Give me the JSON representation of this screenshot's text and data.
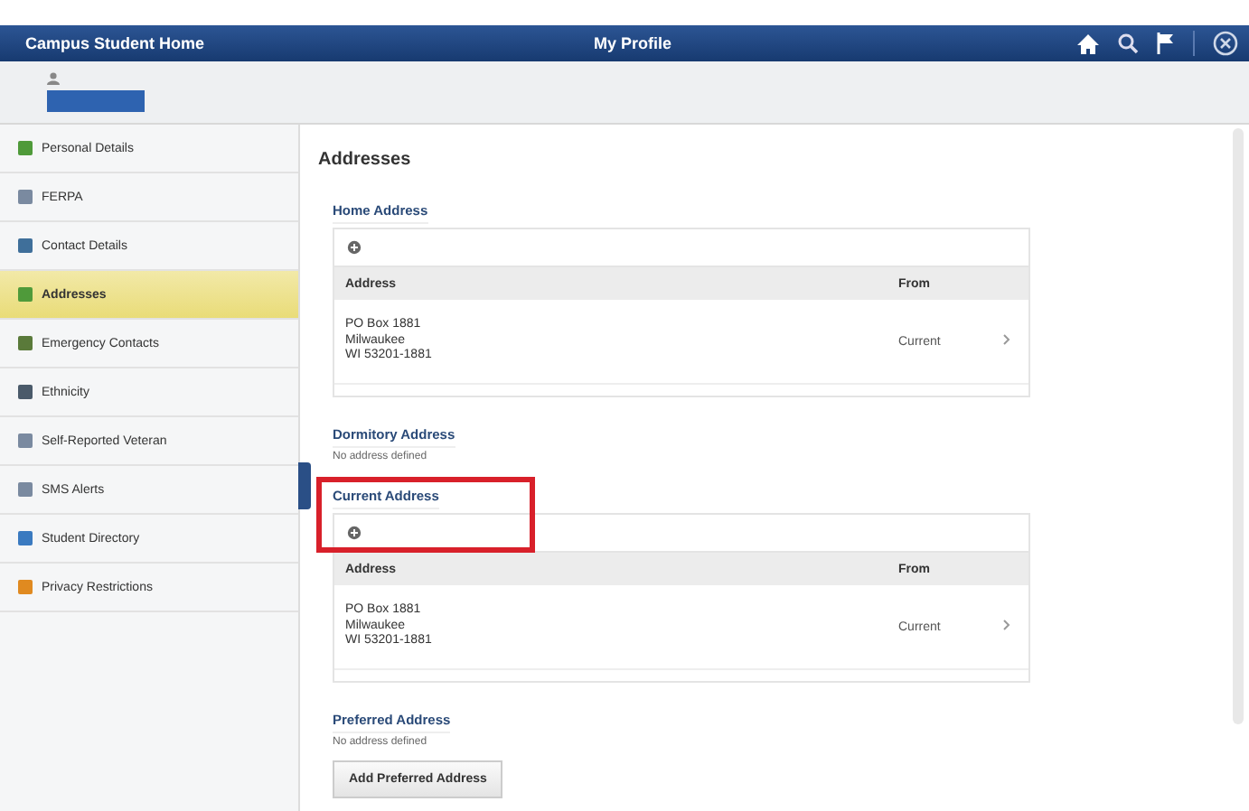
{
  "header": {
    "home_label": "Campus Student Home",
    "title": "My Profile"
  },
  "sidebar": {
    "items": [
      {
        "label": "Personal Details",
        "color": "#4f9a3a",
        "selected": false
      },
      {
        "label": "FERPA",
        "color": "#7a8aa0",
        "selected": false
      },
      {
        "label": "Contact Details",
        "color": "#3f6f9a",
        "selected": false
      },
      {
        "label": "Addresses",
        "color": "#4f9a3a",
        "selected": true
      },
      {
        "label": "Emergency Contacts",
        "color": "#5a7a3a",
        "selected": false
      },
      {
        "label": "Ethnicity",
        "color": "#4a5a6a",
        "selected": false
      },
      {
        "label": "Self-Reported Veteran",
        "color": "#7a8aa0",
        "selected": false
      },
      {
        "label": "SMS Alerts",
        "color": "#7a8aa0",
        "selected": false
      },
      {
        "label": "Student Directory",
        "color": "#3a7ac0",
        "selected": false
      },
      {
        "label": "Privacy Restrictions",
        "color": "#e08a20",
        "selected": false
      }
    ]
  },
  "content": {
    "heading": "Addresses",
    "sections": [
      {
        "kind": "table",
        "title": "Home Address",
        "highlighted": false,
        "columns": [
          "Address",
          "From"
        ],
        "rows": [
          {
            "address": [
              "PO Box 1881",
              "Milwaukee",
              "WI 53201-1881"
            ],
            "from": "Current"
          }
        ]
      },
      {
        "kind": "empty",
        "title": "Dormitory Address",
        "message": "No address defined"
      },
      {
        "kind": "table",
        "title": "Current Address",
        "highlighted": true,
        "columns": [
          "Address",
          "From"
        ],
        "rows": [
          {
            "address": [
              "PO Box 1881",
              "Milwaukee",
              "WI 53201-1881"
            ],
            "from": "Current"
          }
        ]
      },
      {
        "kind": "empty",
        "title": "Preferred Address",
        "message": "No address defined",
        "button": "Add Preferred Address"
      }
    ]
  }
}
